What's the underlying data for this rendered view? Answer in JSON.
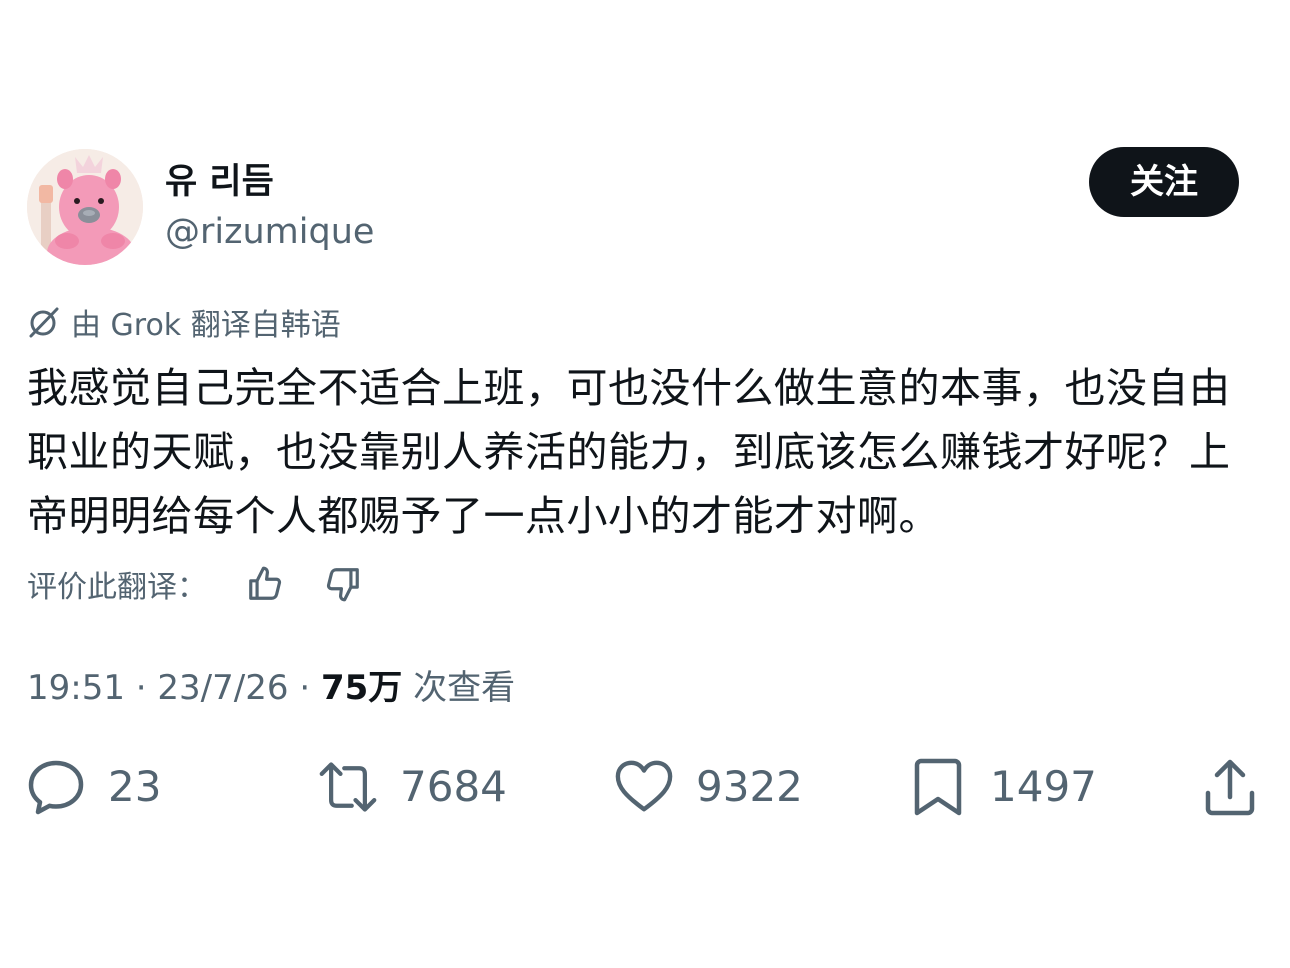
{
  "user": {
    "display_name": "유 리듬",
    "handle": "@rizumique",
    "avatar_icon": "pink-wombat-avatar"
  },
  "follow_button": {
    "label": "关注"
  },
  "translation": {
    "note": "由 Grok 翻译自韩语",
    "icon": "grok-icon"
  },
  "tweet": {
    "text": "我感觉自己完全不适合上班，可也没什么做生意的本事，也没自由职业的天赋，也没靠别人养活的能力，到底该怎么赚钱才好呢？上帝明明给每个人都赐予了一点小小的才能才对啊。"
  },
  "rate_translation": {
    "label": "评价此翻译：",
    "up_icon": "thumbs-up-icon",
    "down_icon": "thumbs-down-icon"
  },
  "meta": {
    "time": "19:51",
    "date": "23/7/26",
    "separator": "·",
    "views_count": "75万",
    "views_label": "次查看"
  },
  "actions": {
    "reply": {
      "icon": "reply-icon",
      "count": "23"
    },
    "retweet": {
      "icon": "retweet-icon",
      "count": "7684"
    },
    "like": {
      "icon": "heart-icon",
      "count": "9322"
    },
    "bookmark": {
      "icon": "bookmark-icon",
      "count": "1497"
    },
    "share": {
      "icon": "share-icon"
    }
  },
  "colors": {
    "text_primary": "#0f1419",
    "text_secondary": "#536471",
    "button_bg": "#0f1419",
    "avatar_pink": "#f39ab8"
  }
}
